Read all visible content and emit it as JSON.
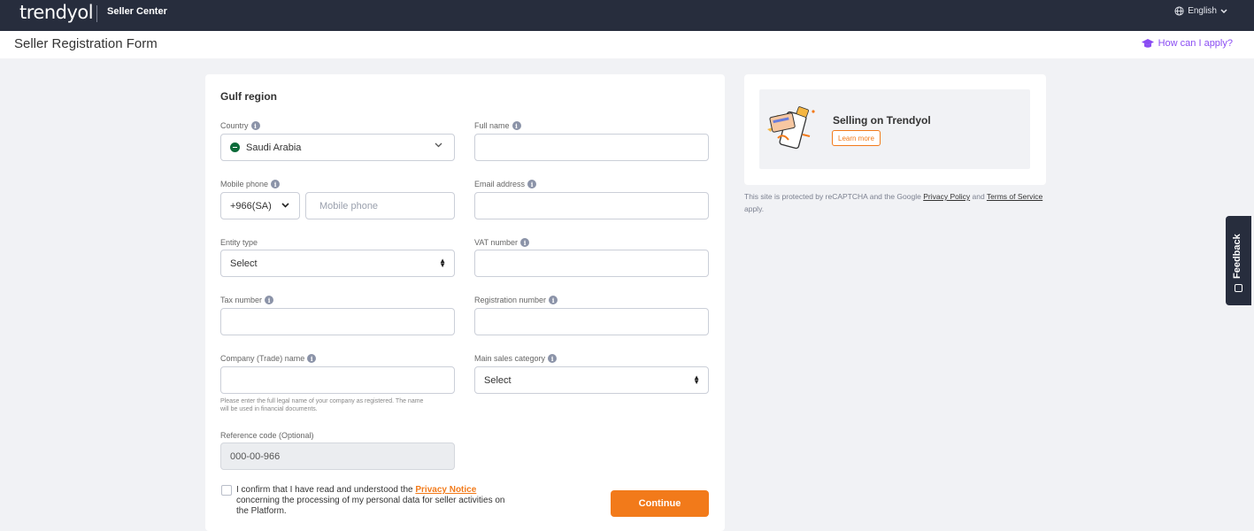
{
  "header": {
    "logo": "trendyol",
    "product": "Seller Center",
    "language": "English"
  },
  "titlebar": {
    "title": "Seller Registration Form",
    "help_link": "How can I apply?"
  },
  "form": {
    "region": "Gulf region",
    "country": {
      "label": "Country",
      "value": "Saudi Arabia"
    },
    "full_name": {
      "label": "Full name",
      "value": ""
    },
    "mobile_phone": {
      "label": "Mobile phone",
      "code": "+966(SA)",
      "placeholder": "Mobile phone"
    },
    "email": {
      "label": "Email address",
      "value": ""
    },
    "entity_type": {
      "label": "Entity type",
      "value": "Select"
    },
    "vat_number": {
      "label": "VAT number",
      "value": ""
    },
    "tax_number": {
      "label": "Tax number",
      "value": ""
    },
    "registration_number": {
      "label": "Registration number",
      "value": ""
    },
    "company_name": {
      "label": "Company (Trade) name",
      "value": "",
      "hint_line1": "Please enter the full legal name of your company as registered. The name",
      "hint_line2": "will be used in financial documents."
    },
    "main_sales_category": {
      "label": "Main sales category",
      "value": "Select"
    },
    "reference_code": {
      "label": "Reference code (Optional)",
      "value": "000-00-966"
    },
    "consent": {
      "prefix": "I confirm that I have read and understood the ",
      "link": "Privacy Notice",
      "suffix": " concerning the processing of my personal data for seller activities on the Platform."
    },
    "continue_label": "Continue"
  },
  "side": {
    "promo_title": "Selling on Trendyol",
    "promo_button": "Learn more",
    "recaptcha_prefix": "This site is protected by reCAPTCHA and the Google ",
    "privacy_link": "Privacy Policy",
    "recaptcha_and": " and ",
    "terms_link": "Terms of Service",
    "recaptcha_suffix": " apply."
  },
  "feedback_label": "Feedback",
  "colors": {
    "brand_orange": "#f27a1a",
    "header_dark": "#272d3d",
    "help_purple": "#8a4cf3"
  }
}
